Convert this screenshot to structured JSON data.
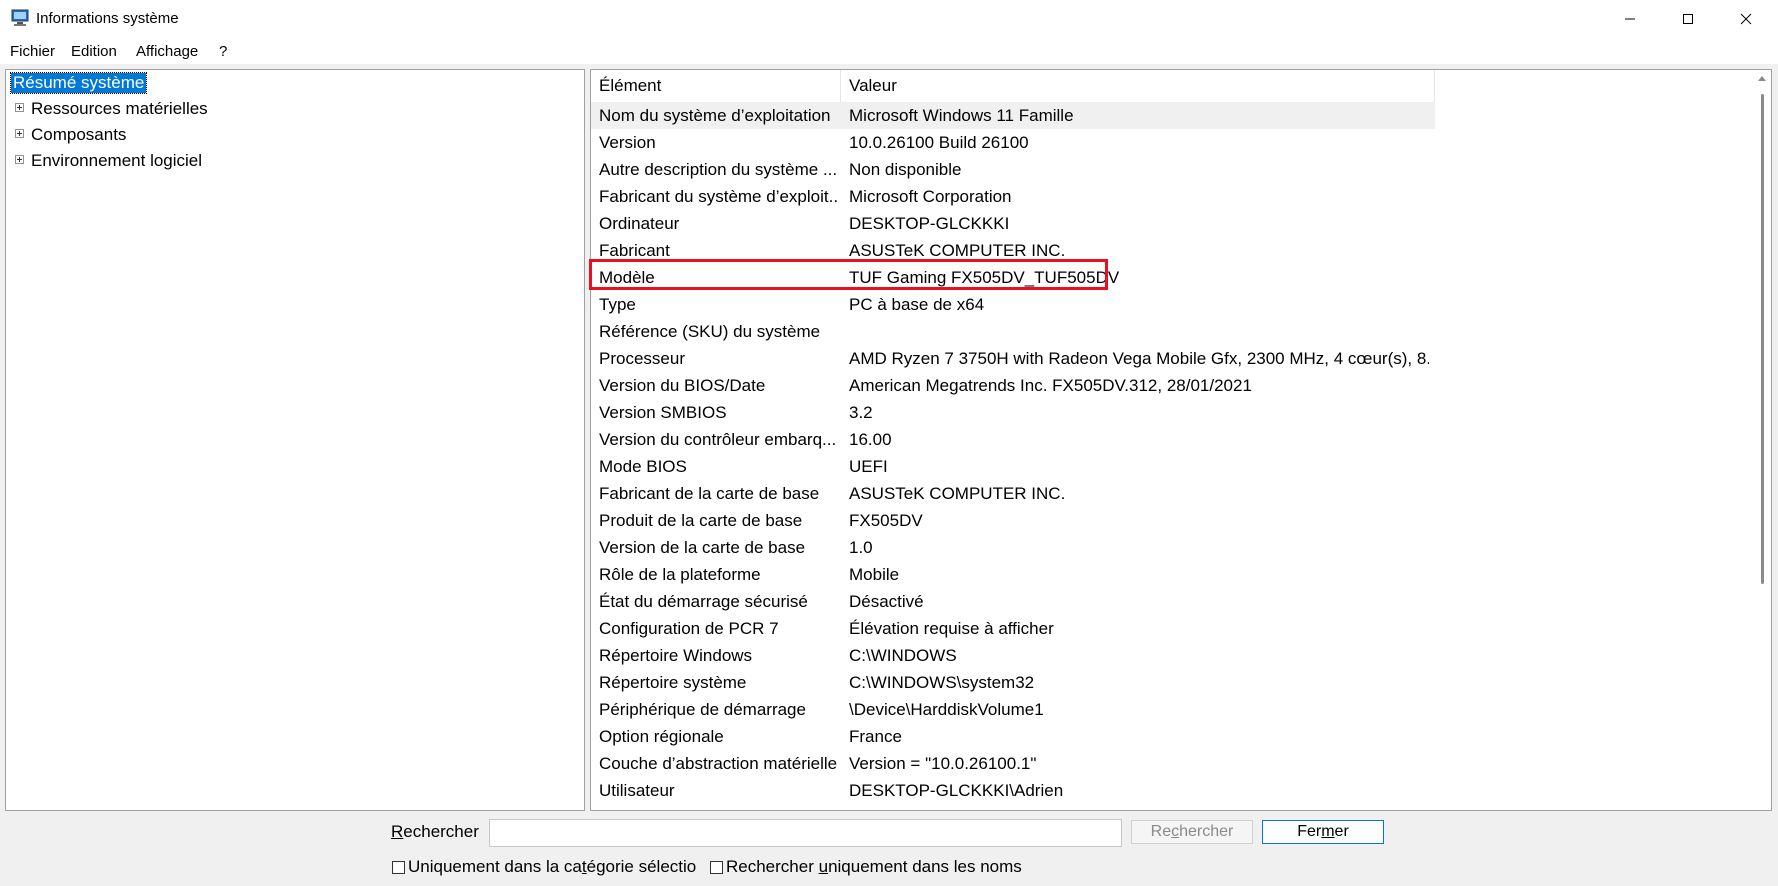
{
  "window": {
    "title": "Informations système"
  },
  "menu": {
    "items": [
      "Fichier",
      "Edition",
      "Affichage",
      "?"
    ]
  },
  "tree": {
    "selected": "Résumé système",
    "items": [
      "Ressources matérielles",
      "Composants",
      "Environnement logiciel"
    ]
  },
  "list": {
    "headers": [
      "Élément",
      "Valeur"
    ],
    "rows": [
      [
        "Nom du système d’exploitation",
        "Microsoft Windows 11 Famille"
      ],
      [
        "Version",
        "10.0.26100 Build 26100"
      ],
      [
        "Autre description du système ...",
        "Non disponible"
      ],
      [
        "Fabricant du système d’exploit...",
        "Microsoft Corporation"
      ],
      [
        "Ordinateur",
        "DESKTOP-GLCKKKI"
      ],
      [
        "Fabricant",
        "ASUSTeK COMPUTER INC."
      ],
      [
        "Modèle",
        "TUF Gaming FX505DV_TUF505DV"
      ],
      [
        "Type",
        "PC à base de x64"
      ],
      [
        "Référence (SKU) du système",
        ""
      ],
      [
        "Processeur",
        "AMD Ryzen 7 3750H with Radeon Vega Mobile Gfx, 2300 MHz, 4 cœur(s), 8..."
      ],
      [
        "Version du BIOS/Date",
        "American Megatrends Inc. FX505DV.312, 28/01/2021"
      ],
      [
        "Version SMBIOS",
        "3.2"
      ],
      [
        "Version du contrôleur embarq...",
        "16.00"
      ],
      [
        "Mode BIOS",
        "UEFI"
      ],
      [
        "Fabricant de la carte de base",
        "ASUSTeK COMPUTER INC."
      ],
      [
        "Produit de la carte de base",
        "FX505DV"
      ],
      [
        "Version de la carte de base",
        "1.0"
      ],
      [
        "Rôle de la plateforme",
        "Mobile"
      ],
      [
        "État du démarrage sécurisé",
        "Désactivé"
      ],
      [
        "Configuration de PCR 7",
        "Élévation requise à afficher"
      ],
      [
        "Répertoire Windows",
        "C:\\WINDOWS"
      ],
      [
        "Répertoire système",
        "C:\\WINDOWS\\system32"
      ],
      [
        "Périphérique de démarrage",
        "\\Device\\HarddiskVolume1"
      ],
      [
        "Option régionale",
        "France"
      ],
      [
        "Couche d’abstraction matérielle",
        "Version = \"10.0.26100.1\""
      ],
      [
        "Utilisateur",
        "DESKTOP-GLCKKKI\\Adrien"
      ]
    ],
    "highlighted_row": "Modèle",
    "highlight_color": "#e81123"
  },
  "search": {
    "label_first": "R",
    "label_rest": "echercher",
    "input_value": "",
    "search_button_pre": "Re",
    "search_button_u": "c",
    "search_button_post": "hercher",
    "close_button_pre": "Fer",
    "close_button_u": "m",
    "close_button_post": "er",
    "checkbox1_pre": "Uniquement dans la ca",
    "checkbox1_u": "t",
    "checkbox1_post": "égorie sélectio",
    "checkbox2_pre": "Rechercher ",
    "checkbox2_u": "u",
    "checkbox2_post": "niquement dans les noms"
  },
  "colors": {
    "selection": "#0078d7",
    "window_bg": "#f0f0f0"
  }
}
